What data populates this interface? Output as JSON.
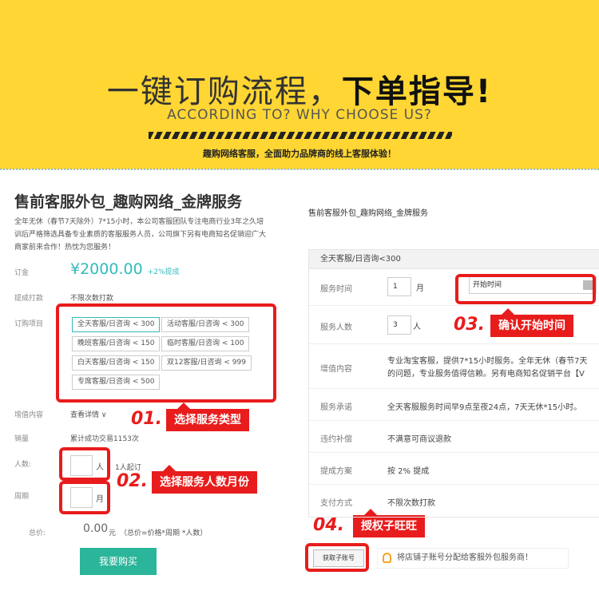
{
  "banner": {
    "title_light": "一键订购流程，",
    "title_bold": "下单指导!",
    "subtitle": "ACCORDING TO? WHY CHOOSE US?",
    "tagline": "趣购网络客服，全面助力品牌商的线上客服体验！"
  },
  "product": {
    "title": "售前客服外包_趣购网络_金牌服务",
    "description": "全年无休（春节7天除外）7*15小时，本公司客服团队专注电商行业3年之久培训后严格筛选具备专业素质的客服服务人员，公司旗下另有电商知名促销迎广大商家前来合作！热忱为您服务！",
    "deposit_label": "订金",
    "deposit_value": "¥2000.00",
    "deposit_note": "+2%提成",
    "bargain_label": "提成打款",
    "bargain_value": "不限次数打款",
    "items_label": "订购项目",
    "items": [
      "全天客服/日咨询 < 300",
      "活动客服/日咨询 < 300",
      "晚班客服/日咨询 < 150",
      "临时客服/日咨询 < 100",
      "白天客服/日咨询 < 150",
      "双12客服/日咨询 < 999",
      "专席客服/日咨询 < 500"
    ],
    "addon_label": "增值内容",
    "addon_value": "查看详情 ∨",
    "sales_label": "销量",
    "sales_value": "累计成功交易1153次",
    "people_label": "人数:",
    "people_unit": "人",
    "people_min": "1人起订",
    "period_label": "周期",
    "period_unit": "月",
    "total_label": "总价:",
    "total_value": "0.00",
    "total_unit": "元",
    "total_formula": "（总价=价格*周期 *人数）",
    "buy_label": "我要购买"
  },
  "callouts": {
    "c1_num": "01.",
    "c1_text": "选择服务类型",
    "c2_num": "02.",
    "c2_text": "选择服务人数月份",
    "c3_num": "03.",
    "c3_text": "确认开始时间",
    "c4_num": "04.",
    "c4_text": "授权子旺旺"
  },
  "form": {
    "title": "售前客服外包_趣购网络_金牌服务",
    "header": "全天客服/日咨询<300",
    "service_time_label": "服务时间",
    "service_time_value": "1",
    "service_time_unit": "月",
    "start_time_placeholder": "开始时间",
    "people_label": "服务人数",
    "people_value": "3",
    "people_unit": "人",
    "addon_label": "增值内容",
    "addon_text_1": "专业淘宝客服，提供7*15小时服务。全年无休（春节7天",
    "addon_text_2": "的问题，专业服务值得信赖。另有电商知名促销平台【V",
    "promise_label": "服务承诺",
    "promise_value": "全天客服服务时间早9点至夜24点，7天无休*15小时。",
    "penalty_label": "违约补偿",
    "penalty_value": "不满意可商议退款",
    "commission_label": "提成方案",
    "commission_value": "按 2% 提成",
    "payment_label": "支付方式",
    "payment_value": "不限次数打款",
    "subaccount_button": "获取子账号",
    "tip_text": "将店铺子账号分配给客服外包服务商！"
  }
}
